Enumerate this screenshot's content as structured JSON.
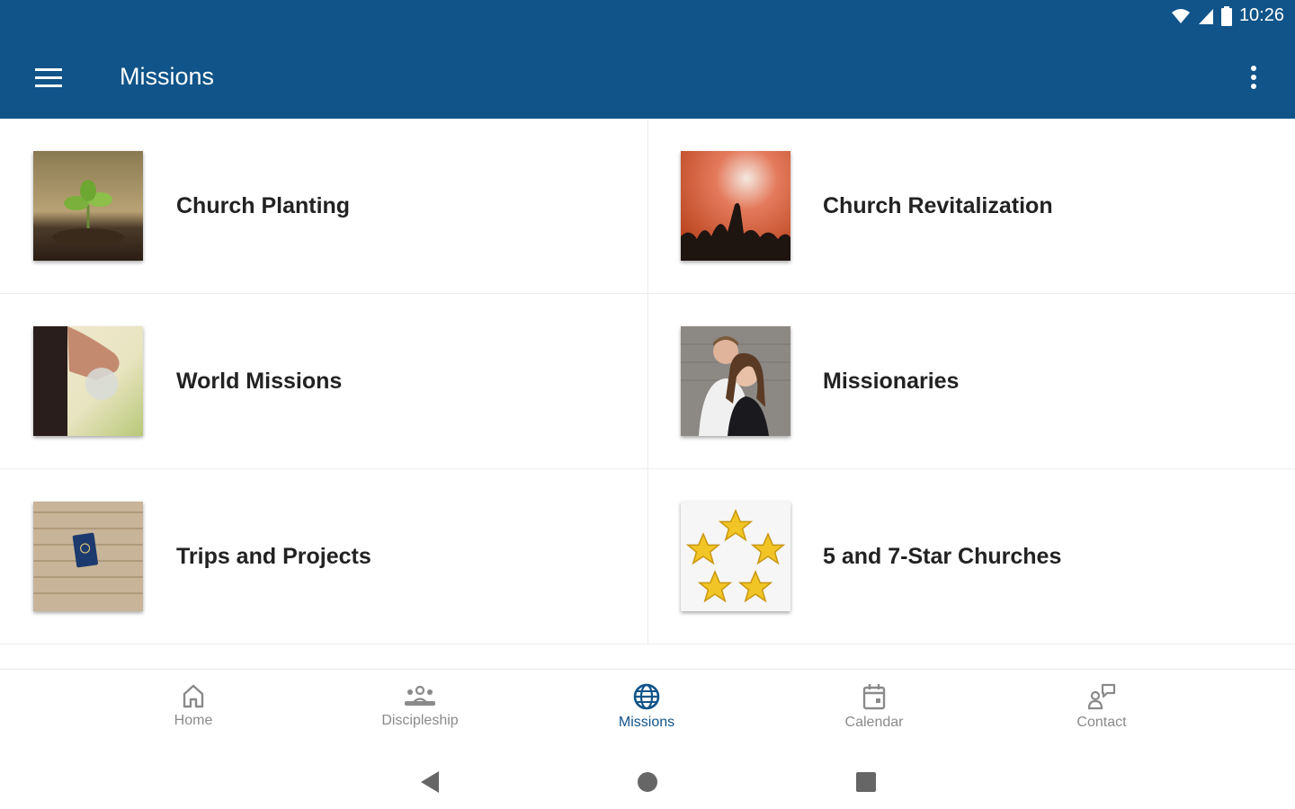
{
  "status_bar": {
    "time": "10:26"
  },
  "app_bar": {
    "title": "Missions"
  },
  "grid": {
    "items": [
      {
        "label": "Church Planting",
        "image": "seedling-photo"
      },
      {
        "label": "Church Revitalization",
        "image": "worship-crowd-photo"
      },
      {
        "label": "World Missions",
        "image": "hands-globe-photo"
      },
      {
        "label": "Missionaries",
        "image": "couple-photo"
      },
      {
        "label": "Trips and Projects",
        "image": "passport-photo"
      },
      {
        "label": "5 and 7-Star Churches",
        "image": "stars-icon"
      }
    ]
  },
  "bottom_nav": {
    "items": [
      {
        "label": "Home",
        "icon": "home-icon"
      },
      {
        "label": "Discipleship",
        "icon": "people-icon"
      },
      {
        "label": "Missions",
        "icon": "globe-icon",
        "active": true
      },
      {
        "label": "Calendar",
        "icon": "calendar-icon"
      },
      {
        "label": "Contact",
        "icon": "contact-icon"
      }
    ]
  },
  "colors": {
    "primary": "#105489",
    "inactive": "#8a8a8a",
    "text": "#222222"
  }
}
